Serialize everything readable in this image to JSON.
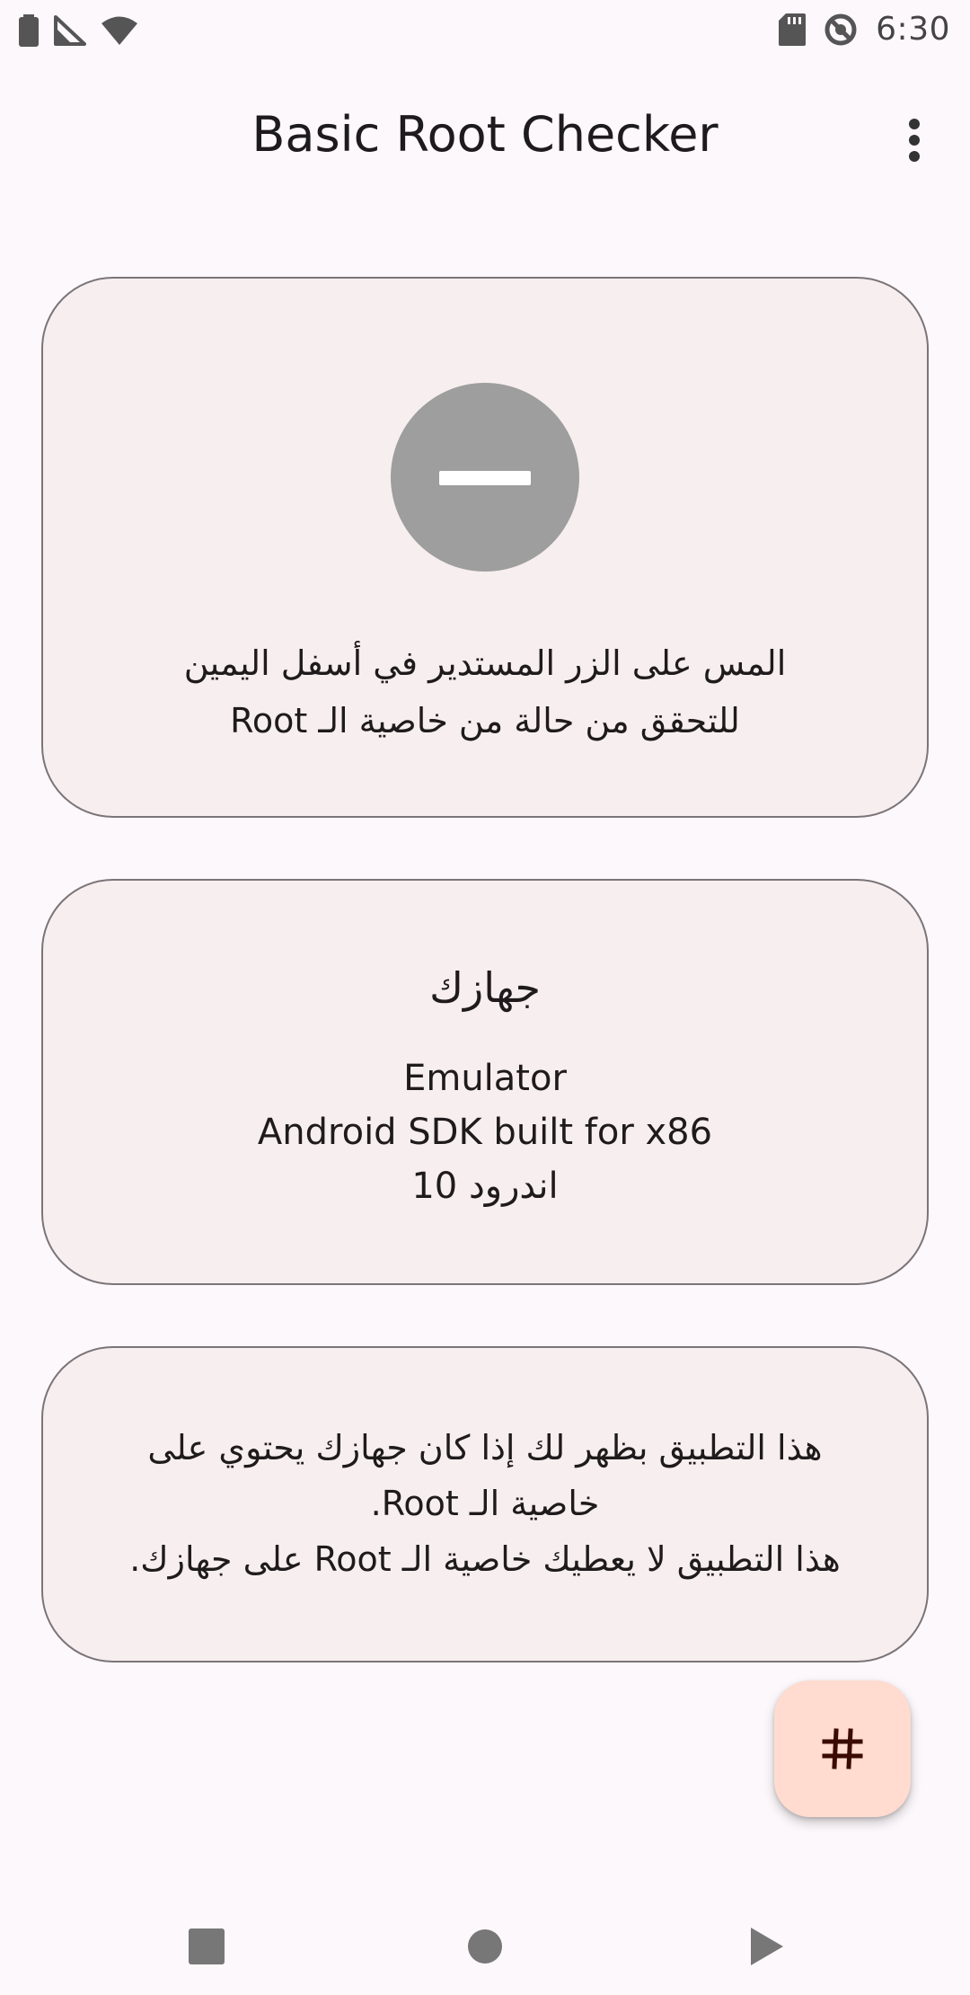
{
  "status_bar": {
    "time": "6:30",
    "icons": [
      "battery-icon",
      "signal-icon",
      "wifi-icon",
      "sd-card-icon",
      "do-not-disturb-icon"
    ]
  },
  "app_bar": {
    "title": "Basic Root Checker",
    "overflow_icon": "more-vert-icon"
  },
  "status_card": {
    "status_icon": "minus-circle-icon",
    "status_color": "#9e9e9e",
    "instruction_line1": "المس على الزر المستدير في أسفل اليمين",
    "instruction_line2": "للتحقق من حالة من خاصية الـ Root"
  },
  "device_card": {
    "heading": "جهازك",
    "model": "Emulator",
    "product": "Android SDK built for x86",
    "android_version": "اندرود 10"
  },
  "info_card": {
    "line1": "هذا التطبيق بظهر لك إذا كان جهازك يحتوي على",
    "line2": "خاصية الـ Root.",
    "line3": "هذا التطبيق لا يعطيك خاصية الـ Root على جهازك."
  },
  "fab": {
    "icon": "hash-icon",
    "color": "#ffdbd0"
  },
  "nav_bar": {
    "icons": [
      "recents-icon",
      "home-icon",
      "back-icon"
    ]
  },
  "colors": {
    "background": "#fdf8fb",
    "card_background": "#f7efef",
    "card_border": "#7b7478"
  }
}
